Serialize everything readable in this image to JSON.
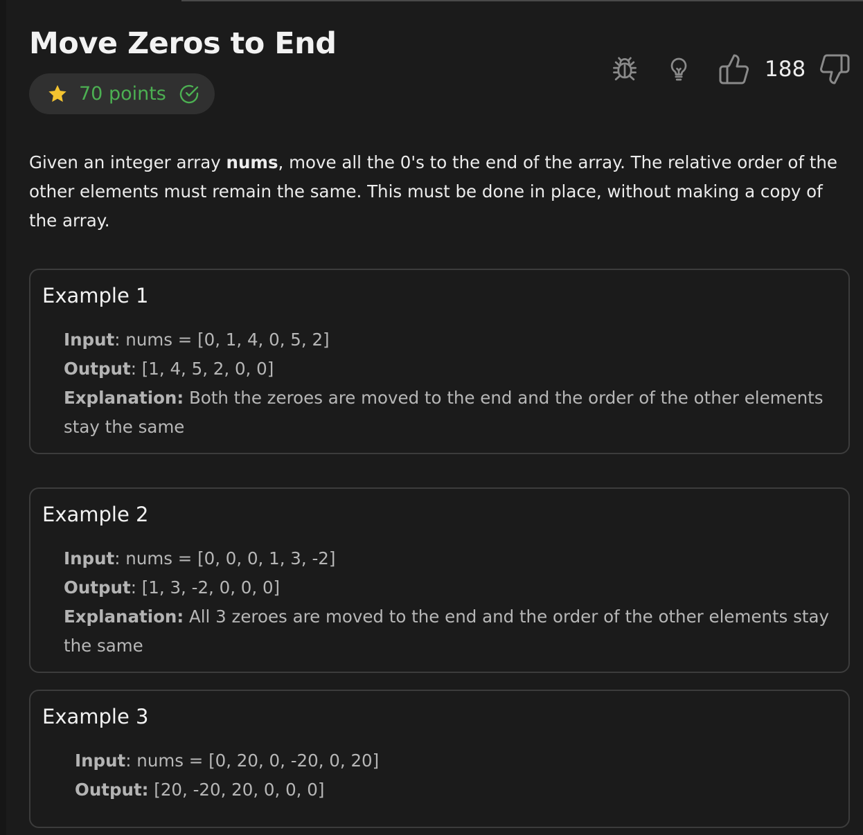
{
  "problem": {
    "title": "Move Zeros to End",
    "points_label": "70 points",
    "like_count": "188"
  },
  "icons": {
    "points": "star-icon",
    "solved": "check-circle-icon",
    "report": "bug-icon",
    "hint": "lightbulb-icon",
    "like": "thumbs-up-icon",
    "dislike": "thumbs-down-icon"
  },
  "colors": {
    "background": "#1b1b1b",
    "accent_green": "#4cb052",
    "star_yellow": "#f4c430",
    "badge_bg": "#303030",
    "border": "#3c3c3c"
  },
  "description": {
    "before": "Given an integer array ",
    "bold": "nums",
    "after": ", move all the 0's to the end of the array. The relative order of the other elements must remain the same. This must be done in place, without making a copy of the array."
  },
  "examples": [
    {
      "title": "Example 1",
      "input_label": "Input",
      "input_value": ": nums = [0, 1, 4, 0, 5, 2]",
      "output_label": "Output",
      "output_value": ": [1, 4, 5, 2, 0, 0]",
      "explanation_label": "Explanation:",
      "explanation_value": " Both the zeroes are moved to the end and the order of the other elements stay the same"
    },
    {
      "title": "Example 2",
      "input_label": "Input",
      "input_value": ": nums = [0, 0, 0, 1, 3, -2]",
      "output_label": "Output",
      "output_value": ": [1, 3, -2, 0, 0, 0]",
      "explanation_label": "Explanation:",
      "explanation_value": " All 3 zeroes are moved to the end and the order of the other elements stay the same"
    },
    {
      "title": "Example 3",
      "input_label": "Input",
      "input_value": ": nums = [0, 20, 0, -20, 0, 20]",
      "output_label": "Output:",
      "output_value": " [20, -20, 20, 0, 0, 0]"
    }
  ]
}
